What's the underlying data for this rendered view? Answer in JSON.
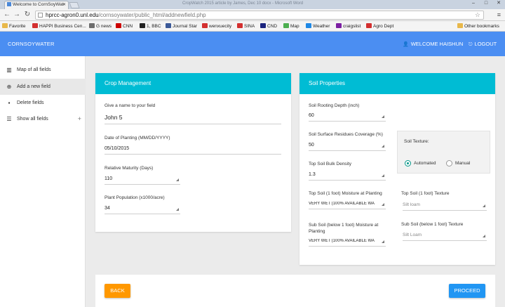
{
  "browser": {
    "tab_title": "Welcome to CornSoyWat",
    "window_title": "CropWatch 2015 article by James, Dec 10 docx - Microsoft Word",
    "url_host": "hprcc-agron0.unl.edu",
    "url_path": "/cornsoywater/public_html/addnewfield.php",
    "bookmarks": [
      {
        "label": "Favorite",
        "color": "#e8b84a"
      },
      {
        "label": "HAPPI Business Cen...",
        "color": "#d32f2f"
      },
      {
        "label": "G news",
        "color": "#6d6d6d"
      },
      {
        "label": "CNN",
        "color": "#cc0000"
      },
      {
        "label": "1, BBC",
        "color": "#222222"
      },
      {
        "label": "Journal Star",
        "color": "#3b5998"
      },
      {
        "label": "wenxuecity",
        "color": "#d32f2f"
      },
      {
        "label": "SINA",
        "color": "#d32f2f"
      },
      {
        "label": "CND",
        "color": "#1a237e"
      },
      {
        "label": "Map",
        "color": "#4caf50"
      },
      {
        "label": "Weather",
        "color": "#1e88e5"
      },
      {
        "label": "craigslist",
        "color": "#7b1fa2"
      },
      {
        "label": "Agro Dept",
        "color": "#d32f2f"
      }
    ],
    "other_bookmarks": "Other bookmarks"
  },
  "app": {
    "brand": "CORNSOYWATER",
    "welcome": "WELCOME HAISHUN",
    "logout": "LOGOUT",
    "accent": "#4b8ef2",
    "card_accent": "#00bcd4"
  },
  "sidebar": {
    "items": [
      {
        "label": "Map of all fields",
        "icon": "map-icon"
      },
      {
        "label": "Add a new field",
        "icon": "add-circle-icon"
      },
      {
        "label": "Delete fields",
        "icon": "trash-icon"
      },
      {
        "label": "Show all fields",
        "icon": "list-icon"
      }
    ]
  },
  "crop": {
    "title": "Crop Management",
    "name_label": "Give a name to your field",
    "name_value": "John 5",
    "date_label": "Date of Planting (MM/DD/YYYY)",
    "date_value": "05/10/2015",
    "maturity_label": "Relative Maturity (Days)",
    "maturity_value": "110",
    "population_label": "Plant Population (x1000/acre)",
    "population_value": "34"
  },
  "soil": {
    "title": "Soil Properties",
    "rooting_label": "Soil Rooting Depth (inch)",
    "rooting_value": "60",
    "residue_label": "Soil Surface Residues Coverage (%)",
    "residue_value": "50",
    "density_label": "Top Soil Bulk Density",
    "density_value": "1.3",
    "top_moisture_label": "Top Soil (1 foot) Moisture at Planting",
    "top_moisture_value": "VERY WET (100% AVAILABLE WA",
    "sub_moisture_label": "Sub Soil (below 1 foot) Moisture at Planting",
    "sub_moisture_value": "VERY WET (100% AVAILABLE WA",
    "texture_label": "Soil Texture:",
    "automated_label": "Automated",
    "manual_label": "Manual",
    "top_texture_label": "Top Soil (1 foot) Texture",
    "top_texture_value": "Silt loam",
    "sub_texture_label": "Sub Soil (below 1 foot) Texture",
    "sub_texture_value": "Silt Loam"
  },
  "actions": {
    "back": "BACK",
    "proceed": "PROCEED",
    "back_color": "#ff9800",
    "proceed_color": "#2196f3"
  }
}
